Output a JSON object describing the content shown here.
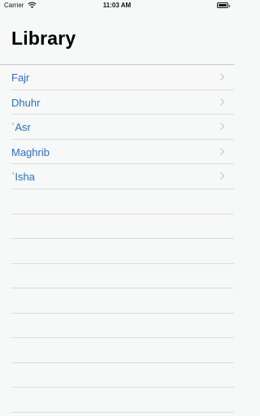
{
  "status_bar": {
    "carrier": "Carrier",
    "time": "11:03 AM",
    "battery_level": 1.0
  },
  "header": {
    "title": "Library"
  },
  "prayers": [
    {
      "label": "Fajr"
    },
    {
      "label": "Dhuhr"
    },
    {
      "label": "ʿAsr"
    },
    {
      "label": "Maghrib"
    },
    {
      "label": "ʿIsha"
    }
  ],
  "colors": {
    "link": "#2a6fc2",
    "background": "#f7f8f8",
    "separator": "#dcdcdf",
    "chevron": "#c7c7cc"
  }
}
